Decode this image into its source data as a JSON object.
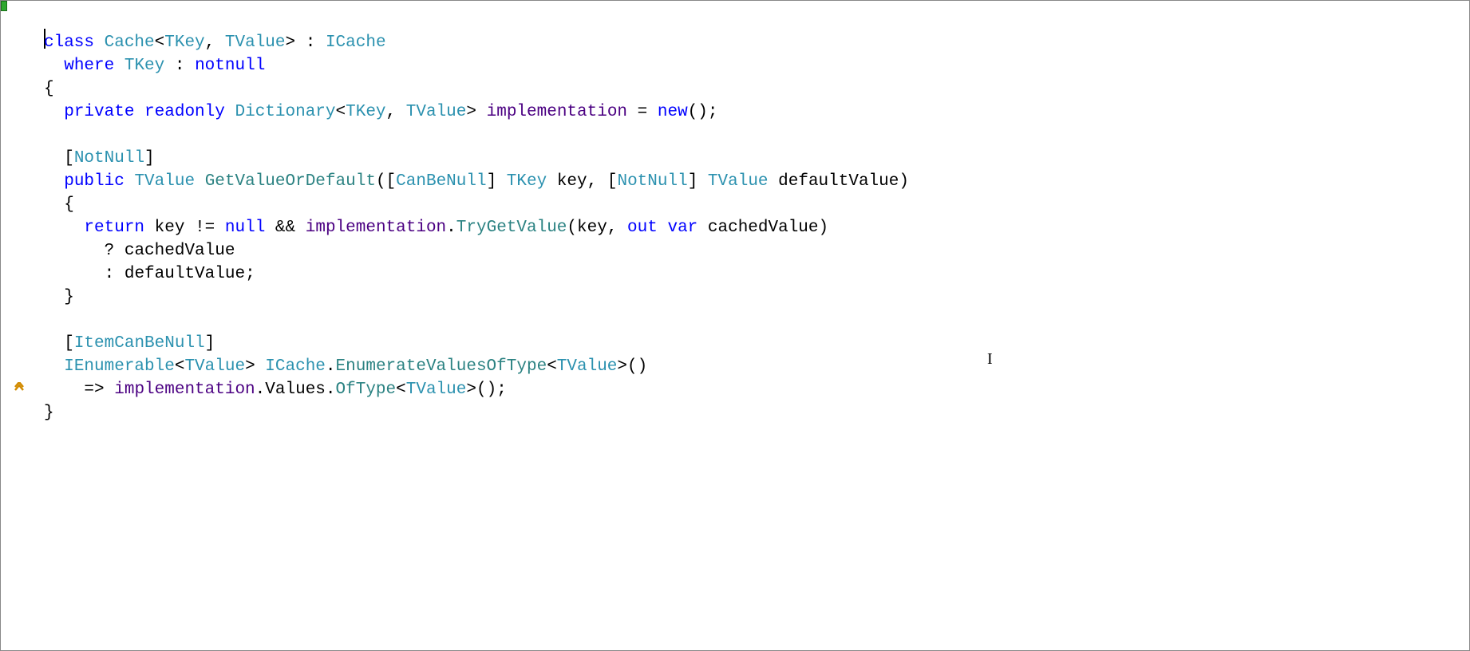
{
  "colors": {
    "keyword": "#0000ff",
    "type": "#2b91af",
    "field": "#4b0082",
    "method": "#2b8282",
    "default": "#000000"
  },
  "gutter": {
    "chevron_icon": "chevron-up",
    "marker": "green-modified"
  },
  "code": {
    "l1": {
      "class": "class",
      "Cache": "Cache",
      "lt": "<",
      "TKey": "TKey",
      "comma": ",",
      "sp": " ",
      "TValue": "TValue",
      "gt": ">",
      "colon": " : ",
      "ICache": "ICache"
    },
    "l2": {
      "where": "where",
      "sp": " ",
      "TKey": "TKey",
      "colon": " : ",
      "notnull": "notnull"
    },
    "l3": {
      "brace": "{"
    },
    "l4": {
      "private": "private",
      "sp": " ",
      "readonly": "readonly",
      "Dictionary": "Dictionary",
      "lt": "<",
      "TKey": "TKey",
      "comma": ",",
      "TValue": "TValue",
      "gt": ">",
      "impl": "implementation",
      "eq": " = ",
      "new": "new",
      "paren": "();"
    },
    "l5": {
      "lbrack": "[",
      "NotNull": "NotNull",
      "rbrack": "]"
    },
    "l6": {
      "public": "public",
      "sp": " ",
      "TValue": "TValue",
      "GetValueOrDefault": "GetValueOrDefault",
      "lp": "(",
      "lb1": "[",
      "CanBeNull": "CanBeNull",
      "rb1": "]",
      "TKey": "TKey",
      "key": "key",
      "comma": ",",
      "lb2": "[",
      "NotNull": "NotNull",
      "rb2": "]",
      "TValue2": "TValue",
      "defaultValue": "defaultValue",
      "rp": ")"
    },
    "l7": {
      "brace": "{"
    },
    "l8": {
      "return": "return",
      "sp": " ",
      "key": "key",
      "neq": " != ",
      "null": "null",
      "and": " && ",
      "impl": "implementation",
      "dot": ".",
      "TryGetValue": "TryGetValue",
      "lp": "(",
      "key2": "key",
      "comma": ",",
      "out": "out",
      "var": "var",
      "cachedValue": "cachedValue",
      "rp": ")"
    },
    "l9": {
      "q": "? ",
      "cachedValue": "cachedValue"
    },
    "l10": {
      "colon": ": ",
      "defaultValue": "defaultValue",
      "semi": ";"
    },
    "l11": {
      "brace": "}"
    },
    "l12": {
      "lb": "[",
      "ItemCanBeNull": "ItemCanBeNull",
      "rb": "]"
    },
    "l13": {
      "IEnumerable": "IEnumerable",
      "lt": "<",
      "TValue": "TValue",
      "gt": ">",
      "sp": " ",
      "ICache": "ICache",
      "dot": ".",
      "EnumerateValuesOfType": "EnumerateValuesOfType",
      "lt2": "<",
      "TValue2": "TValue",
      "gt2": ">",
      "paren": "()"
    },
    "l14": {
      "arrow": "=> ",
      "impl": "implementation",
      "dot1": ".",
      "Values": "Values",
      "dot2": ".",
      "OfType": "OfType",
      "lt": "<",
      "TValue": "TValue",
      "gt": ">",
      "paren": "();"
    },
    "l15": {
      "brace": "}"
    }
  }
}
